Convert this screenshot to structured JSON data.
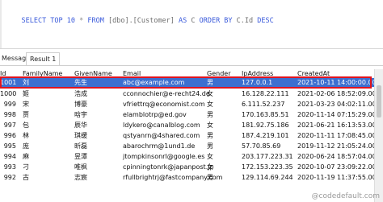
{
  "editor": {
    "code_parts": {
      "select": "SELECT TOP 10",
      "star": " * ",
      "from": "FROM",
      "table": " [dbo].[Customer] ",
      "as": "AS",
      "alias": " C ",
      "order": "ORDER BY",
      "col": " C.Id ",
      "desc": "DESC"
    }
  },
  "tabs": {
    "messages": "Message",
    "result": "Result 1"
  },
  "grid": {
    "columns": [
      "Id",
      "FamilyName",
      "GivenName",
      "Email",
      "Gender",
      "IpAddress",
      "CreatedAt"
    ],
    "rows": [
      [
        "1001",
        "刘",
        "先生",
        "abc@example.com",
        "男",
        "127.0.0.1",
        "2021-10-11 14:00:00.000"
      ],
      [
        "1000",
        "姬",
        "浩成",
        "cconnochier@e-recht24.de",
        "女",
        "16.128.22.111",
        "2021-02-06 18:52:09.000"
      ],
      [
        "999",
        "宋",
        "博豪",
        "vfriettrq@economist.com",
        "女",
        "6.111.52.237",
        "2021-03-23 04:02:11.000"
      ],
      [
        "998",
        "贾",
        "晗宇",
        "elamblotrp@ed.gov",
        "男",
        "170.163.85.51",
        "2020-11-14 07:15:29.000"
      ],
      [
        "997",
        "包",
        "辰华",
        "ldykero@canalblog.com",
        "女",
        "181.92.75.186",
        "2021-06-21 16:13:53.000"
      ],
      [
        "996",
        "林",
        "琪缓",
        "qstyanrn@4shared.com",
        "男",
        "187.4.219.101",
        "2020-11-11 17:08:45.000"
      ],
      [
        "995",
        "庞",
        "昕磊",
        "abarochrm@1und1.de",
        "男",
        "57.70.85.69",
        "2019-11-12 21:05:24.000"
      ],
      [
        "994",
        "麻",
        "昱潭",
        "jtompkinsonrl@google.es",
        "女",
        "203.177.223.31",
        "2020-06-24 18:57:04.000"
      ],
      [
        "993",
        "刁",
        "唯枫",
        "cpinningtonrk@japanpost.jp",
        "女",
        "172.153.223.35",
        "2020-10-07 23:09:22.000"
      ],
      [
        "992",
        "古",
        "志宸",
        "rfullbrightrj@fastcompany.com",
        "男",
        "129.114.69.244",
        "2020-11-19 11:37:55.000"
      ]
    ]
  },
  "watermark": "@codedefault.com"
}
